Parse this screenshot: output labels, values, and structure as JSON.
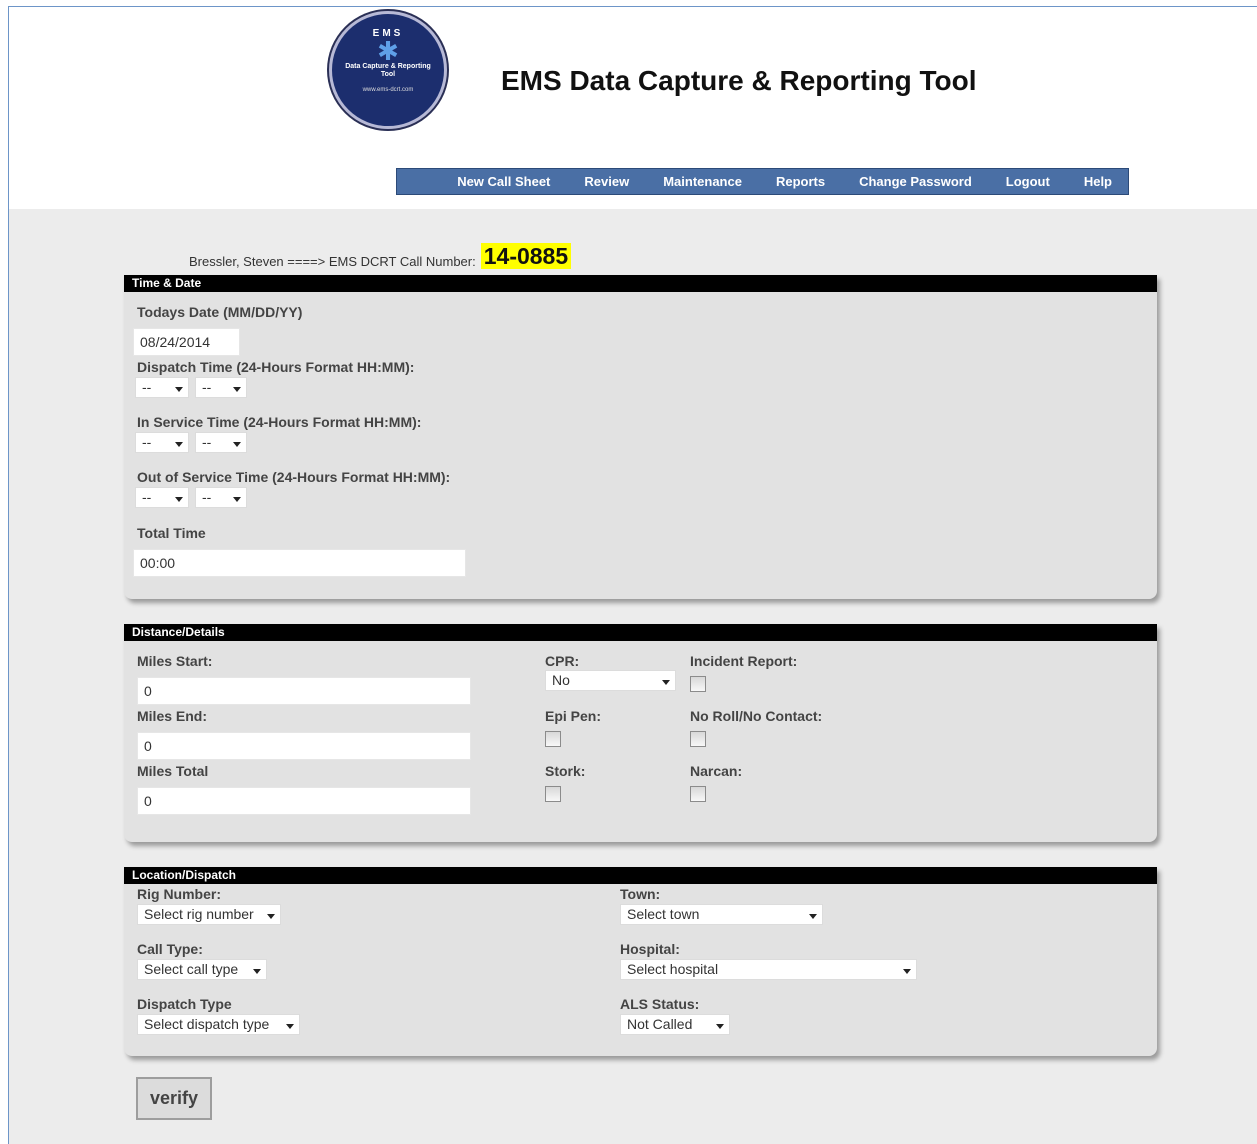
{
  "header": {
    "logo": {
      "top": "EMS",
      "middle": "Data Capture & Reporting Tool",
      "bottom": "www.ems-dcrt.com"
    },
    "title": "EMS Data Capture & Reporting Tool"
  },
  "nav": [
    "New Call Sheet",
    "Review",
    "Maintenance",
    "Reports",
    "Change Password",
    "Logout",
    "Help"
  ],
  "caller": {
    "text": "Bressler, Steven ====> EMS DCRT Call Number:",
    "call_number": "14-0885"
  },
  "time_date": {
    "title": "Time & Date",
    "todays_date_label": "Todays Date (MM/DD/YY)",
    "todays_date_value": "08/24/2014",
    "dispatch_label": "Dispatch Time (24-Hours Format HH:MM):",
    "in_service_label": "In Service Time (24-Hours Format HH:MM):",
    "out_service_label": "Out of Service Time (24-Hours Format HH:MM):",
    "time_placeholder": "--",
    "total_label": "Total Time",
    "total_value": "00:00"
  },
  "distance": {
    "title": "Distance/Details",
    "miles_start_label": "Miles Start:",
    "miles_start_value": "0",
    "miles_end_label": "Miles End:",
    "miles_end_value": "0",
    "miles_total_label": "Miles Total",
    "miles_total_value": "0",
    "cpr_label": "CPR:",
    "cpr_value": "No",
    "epi_label": "Epi Pen:",
    "stork_label": "Stork:",
    "incident_label": "Incident Report:",
    "noroll_label": "No Roll/No Contact:",
    "narcan_label": "Narcan:"
  },
  "location": {
    "title": "Location/Dispatch",
    "rig_label": "Rig Number:",
    "rig_value": "Select rig number",
    "calltype_label": "Call Type:",
    "calltype_value": "Select call type",
    "dispatch_label": "Dispatch Type",
    "dispatch_value": "Select dispatch type",
    "town_label": "Town:",
    "town_value": "Select town",
    "hospital_label": "Hospital:",
    "hospital_value": "Select hospital",
    "als_label": "ALS Status:",
    "als_value": "Not Called"
  },
  "verify_label": "verify"
}
